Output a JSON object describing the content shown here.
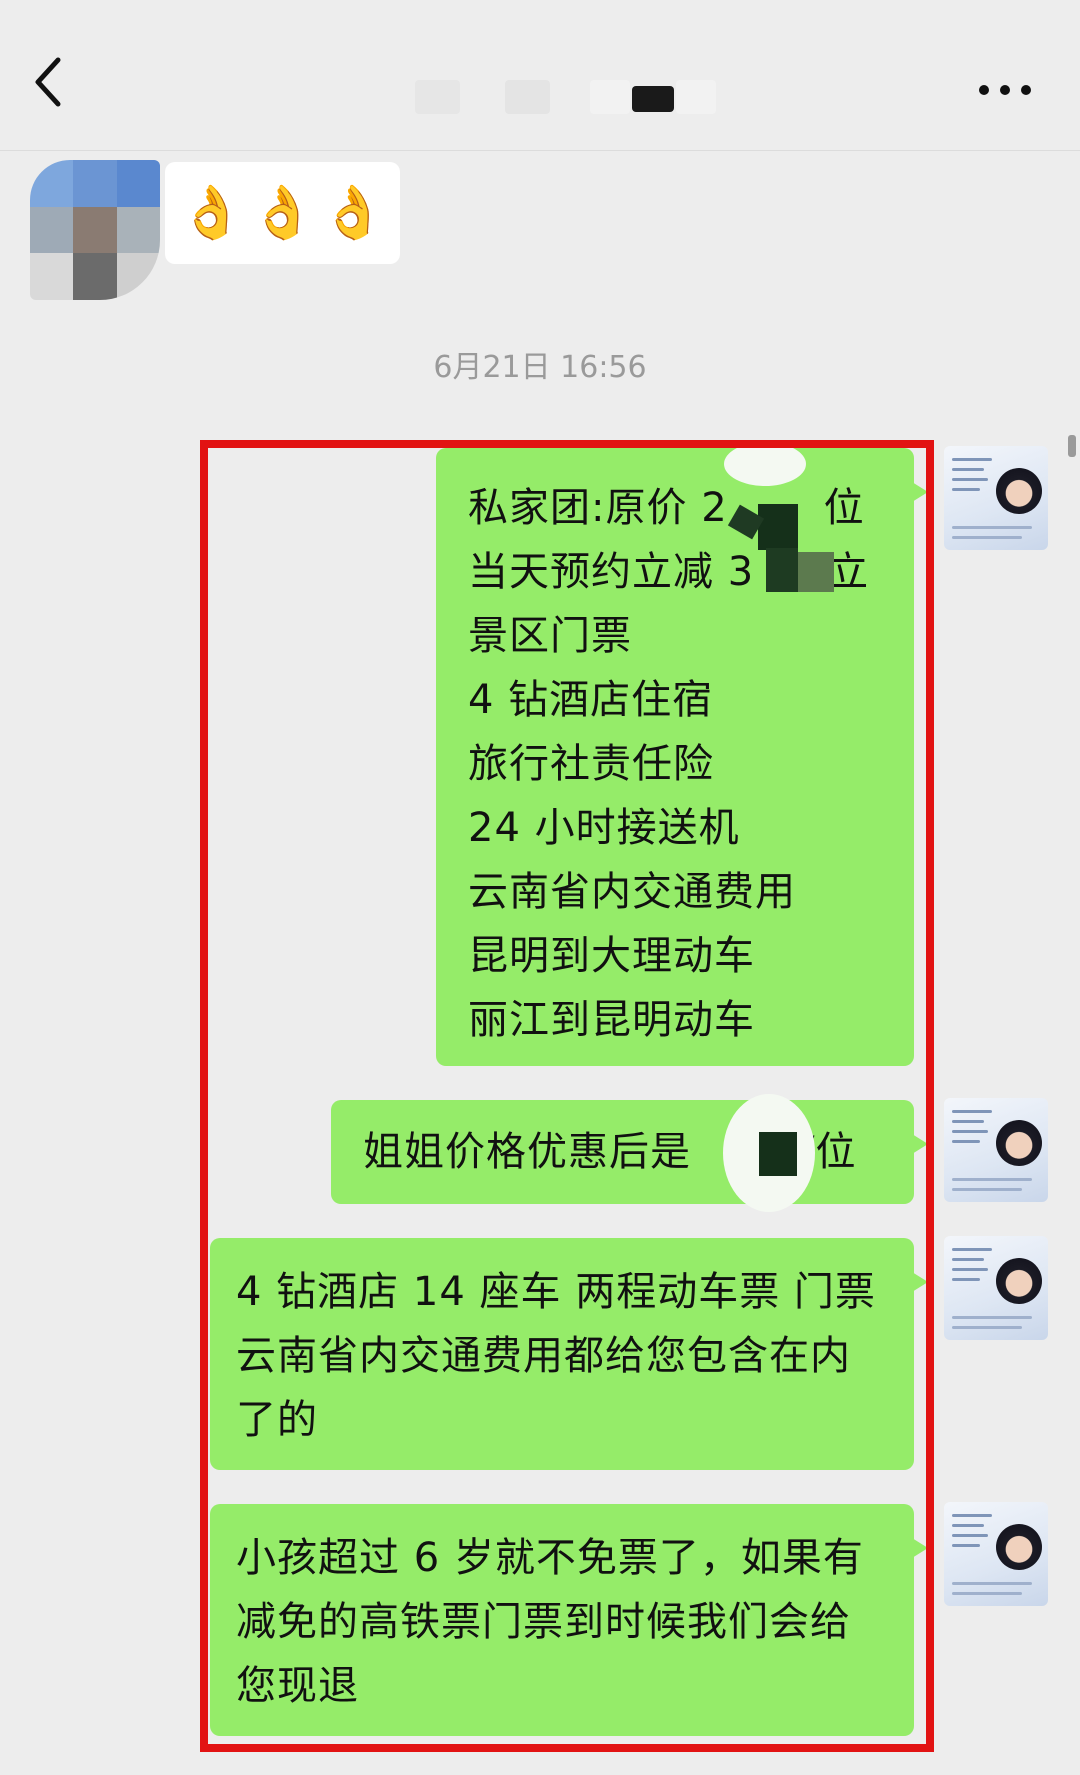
{
  "header": {
    "back_icon": "chevron-left-icon",
    "more_icon": "ellipsis-icon"
  },
  "incoming": {
    "emojis": [
      "👌",
      "👌",
      "👌"
    ]
  },
  "timestamp": "6月21日 16:56",
  "messages": [
    {
      "lines": [
        "私家团:原价 2",
        "当天预约立减 3",
        "景区门票",
        "4 钻酒店住宿",
        "旅行社责任险",
        "24 小时接送机",
        "云南省内交通费用",
        "昆明到大理动车",
        "丽江到昆明动车"
      ],
      "line_tails": [
        "位",
        "立"
      ]
    },
    {
      "lines": [
        "姐姐价格优惠后是"
      ],
      "tail": "/位"
    },
    {
      "lines": [
        "4 钻酒店 14 座车 两程动车票 门票",
        "云南省内交通费用都给您包含在内",
        "了的"
      ]
    },
    {
      "lines": [
        "小孩超过 6 岁就不免票了，如果有",
        "减免的高铁票门票到时候我们会给",
        "您现退"
      ]
    }
  ],
  "colors": {
    "background": "#ededed",
    "bubble_outgoing": "#95ec69",
    "bubble_incoming": "#ffffff",
    "highlight": "#e21313",
    "timestamp": "#9a9a9a"
  }
}
